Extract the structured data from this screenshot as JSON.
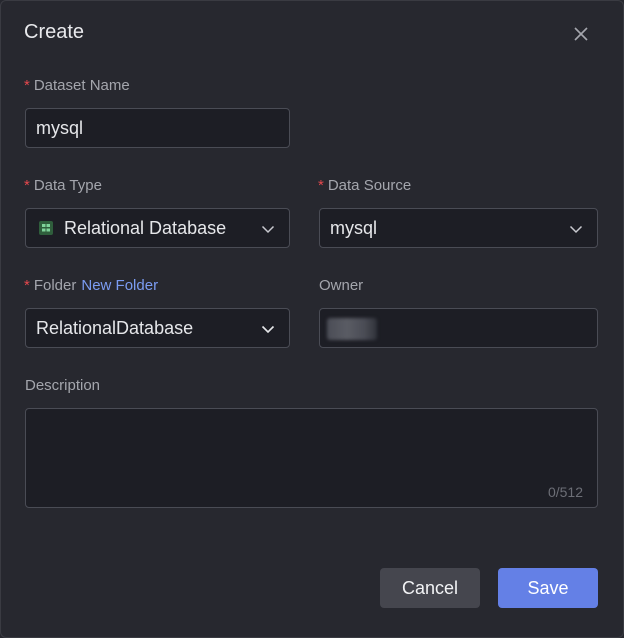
{
  "dialog": {
    "title": "Create"
  },
  "form": {
    "dataset_name": {
      "label": "Dataset Name",
      "required_mark": "*",
      "value": "mysql"
    },
    "data_type": {
      "label": "Data Type",
      "required_mark": "*",
      "value": "Relational Database",
      "icon": "database-icon"
    },
    "data_source": {
      "label": "Data Source",
      "required_mark": "*",
      "value": "mysql"
    },
    "folder": {
      "label": "Folder",
      "required_mark": "*",
      "link": "New Folder",
      "value": "RelationalDatabase"
    },
    "owner": {
      "label": "Owner"
    },
    "description": {
      "label": "Description",
      "value": "",
      "counter": "0/512"
    }
  },
  "actions": {
    "cancel_label": "Cancel",
    "save_label": "Save"
  },
  "colors": {
    "background": "#27282f",
    "field_background": "#1d1e25",
    "required": "#e5484d",
    "link": "#7b9cf2",
    "primary": "#6480e6"
  }
}
